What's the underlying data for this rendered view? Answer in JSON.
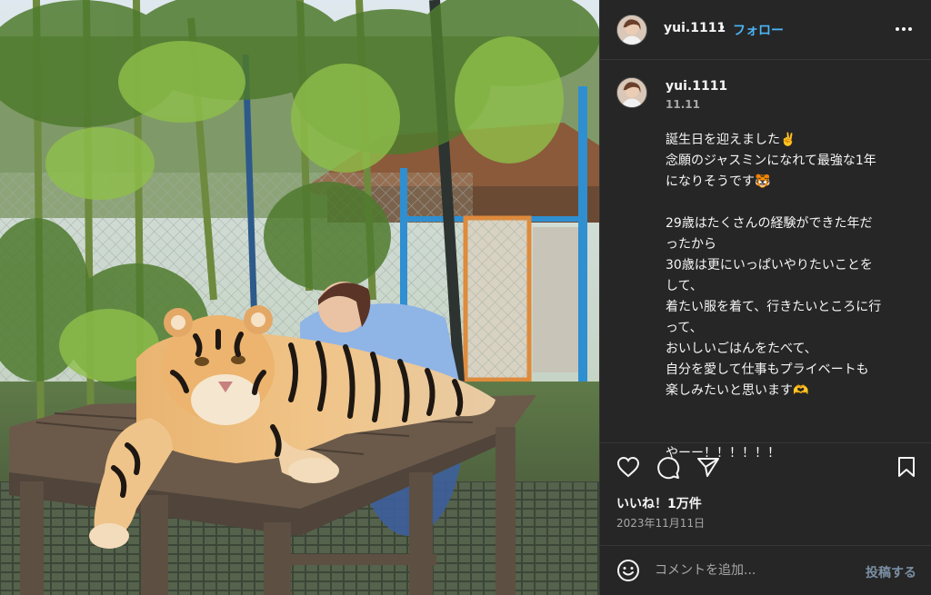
{
  "header": {
    "username": "yui.1111",
    "separator": "•",
    "follow_label": "フォロー",
    "more_icon": "more-horizontal-icon"
  },
  "caption": {
    "username": "yui.1111",
    "date_short": "11.11",
    "lines": [
      "誕生日を迎えました✌️",
      "念願のジャスミンになれて最強な1年",
      "になりそうです🐯",
      "",
      "29歳はたくさんの経験ができた年だ",
      "ったから",
      "30歳は更にいっぱいやりたいことを",
      "して、",
      "着たい服を着て、行きたいところに行",
      "って、",
      "おいしいごはんをたべて、",
      "自分を愛して仕事もプライベートも",
      "楽しみたいと思います🫶",
      "",
      "",
      "やーー！！！！！！"
    ]
  },
  "actions": {
    "like_icon": "heart-icon",
    "comment_icon": "comment-icon",
    "share_icon": "send-icon",
    "save_icon": "bookmark-icon"
  },
  "likes_text": "いいね！1万件",
  "post_date": "2023年11月11日",
  "comment": {
    "emoji_icon": "smiley-icon",
    "placeholder": "コメントを追加...",
    "post_label": "投稿する"
  },
  "colors": {
    "panel_bg": "#262626",
    "link_blue": "#4cb5f9",
    "muted_text": "#a8a8a8",
    "post_button": "#7a8fa3"
  }
}
